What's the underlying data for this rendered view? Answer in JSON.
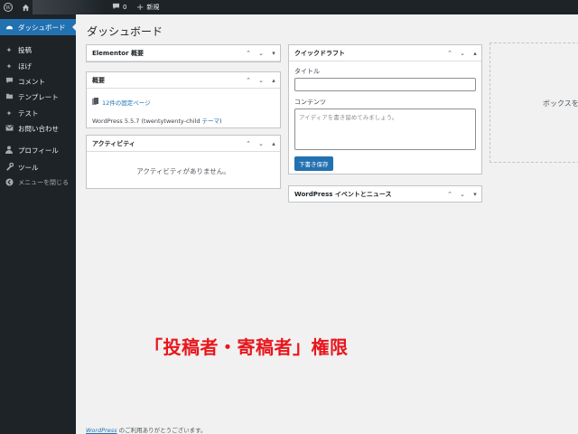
{
  "admin_bar": {
    "comments_count": "0",
    "new_label": "新規"
  },
  "sidebar": {
    "items": [
      {
        "label": "ダッシュボード",
        "icon": "dashboard-icon",
        "current": true
      },
      {
        "label": "投稿",
        "icon": "pin-icon"
      },
      {
        "label": "ほげ",
        "icon": "pin-icon"
      },
      {
        "label": "コメント",
        "icon": "comment-icon"
      },
      {
        "label": "テンプレート",
        "icon": "folder-icon"
      },
      {
        "label": "テスト",
        "icon": "pin-icon"
      },
      {
        "label": "お問い合わせ",
        "icon": "mail-icon"
      },
      {
        "label": "プロフィール",
        "icon": "user-icon"
      },
      {
        "label": "ツール",
        "icon": "wrench-icon"
      },
      {
        "label": "メニューを閉じる",
        "icon": "collapse-icon"
      }
    ]
  },
  "page": {
    "title": "ダッシュボード"
  },
  "boxes": {
    "elementor": {
      "title": "Elementor 概要"
    },
    "glance": {
      "title": "概要",
      "pages_text": "12件の固定ページ",
      "version_text": "WordPress 5.5.7 (twentytwenty-child ",
      "theme_link": "テーマ",
      "version_suffix": ")"
    },
    "activity": {
      "title": "アクティビティ",
      "empty_text": "アクティビティがありません。"
    },
    "quickdraft": {
      "title": "クイックドラフト",
      "title_label": "タイトル",
      "content_label": "コンテンツ",
      "content_placeholder": "アイディアを書き留めてみましょう。",
      "save_button": "下書き保存"
    },
    "news": {
      "title": "WordPress イベントとニュース"
    }
  },
  "dropzone": {
    "text": "ボックスを"
  },
  "overlay": {
    "caption": "「投稿者・寄稿者」権限",
    "color": "#e8161c"
  },
  "footer": {
    "link": "WordPress",
    "text": " のご利用ありがとうございます。"
  },
  "colors": {
    "accent": "#2271b1",
    "admin_bg": "#1d2327"
  }
}
